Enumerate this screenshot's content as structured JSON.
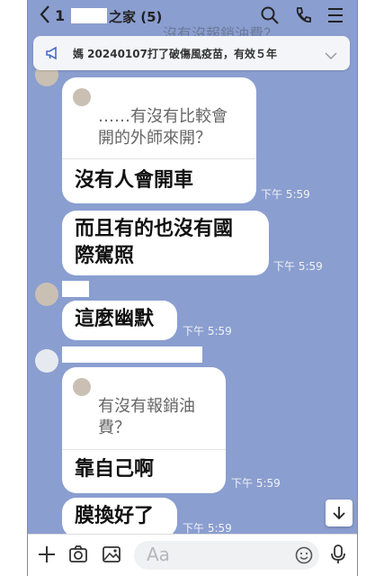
{
  "header": {
    "back_icon": "chevron-left-icon",
    "count_prefix": "1",
    "title": "之家 (5)",
    "ghost_text": "沒有沒報銷油費？",
    "icons": [
      "search-icon",
      "phone-icon",
      "menu-icon"
    ]
  },
  "notice": {
    "icon": "megaphone-icon",
    "text": "媽 20240107打了破傷風疫苗，有效５年",
    "expand_icon": "chevron-down-icon"
  },
  "messages": [
    {
      "quote": "……有沒有比較會\n開的外師來開？",
      "text": "沒有人會開車",
      "time": "下午 5:59"
    },
    {
      "text": "而且有的也沒有國\n際駕照",
      "time": "下午 5:59"
    },
    {
      "text": "這麼幽默",
      "time": "下午 5:59"
    },
    {
      "quote": "有沒有報銷油\n費？",
      "text": "靠自己啊",
      "time": "下午 5:59"
    },
    {
      "text": "膜換好了",
      "time": "下午 5:59"
    }
  ],
  "input": {
    "placeholder": "Aa",
    "icons": [
      "plus-icon",
      "camera-icon",
      "image-icon",
      "emoji-icon",
      "microphone-icon"
    ]
  },
  "colors": {
    "chat_bg": "#8a9ed0",
    "bubble": "#ffffff",
    "timestamp": "#f2f2f2"
  }
}
